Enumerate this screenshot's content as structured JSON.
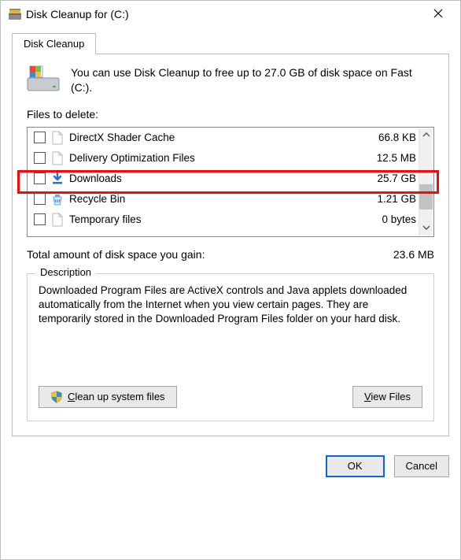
{
  "window": {
    "title": "Disk Cleanup for  (C:)"
  },
  "tab": {
    "label": "Disk Cleanup"
  },
  "intro": "You can use Disk Cleanup to free up to 27.0 GB of disk space on Fast (C:).",
  "files_label": "Files to delete:",
  "files": [
    {
      "name": "DirectX Shader Cache",
      "size": "66.8 KB",
      "icon": "page"
    },
    {
      "name": "Delivery Optimization Files",
      "size": "12.5 MB",
      "icon": "page"
    },
    {
      "name": "Downloads",
      "size": "25.7 GB",
      "icon": "download"
    },
    {
      "name": "Recycle Bin",
      "size": "1.21 GB",
      "icon": "recycle"
    },
    {
      "name": "Temporary files",
      "size": "0 bytes",
      "icon": "page"
    }
  ],
  "highlight_index": 2,
  "total": {
    "label": "Total amount of disk space you gain:",
    "value": "23.6 MB"
  },
  "description": {
    "heading": "Description",
    "body": "Downloaded Program Files are ActiveX controls and Java applets downloaded automatically from the Internet when you view certain pages. They are temporarily stored in the Downloaded Program Files folder on your hard disk."
  },
  "buttons": {
    "clean_system": "Clean up system files",
    "view_files": "View Files",
    "ok": "OK",
    "cancel": "Cancel"
  }
}
